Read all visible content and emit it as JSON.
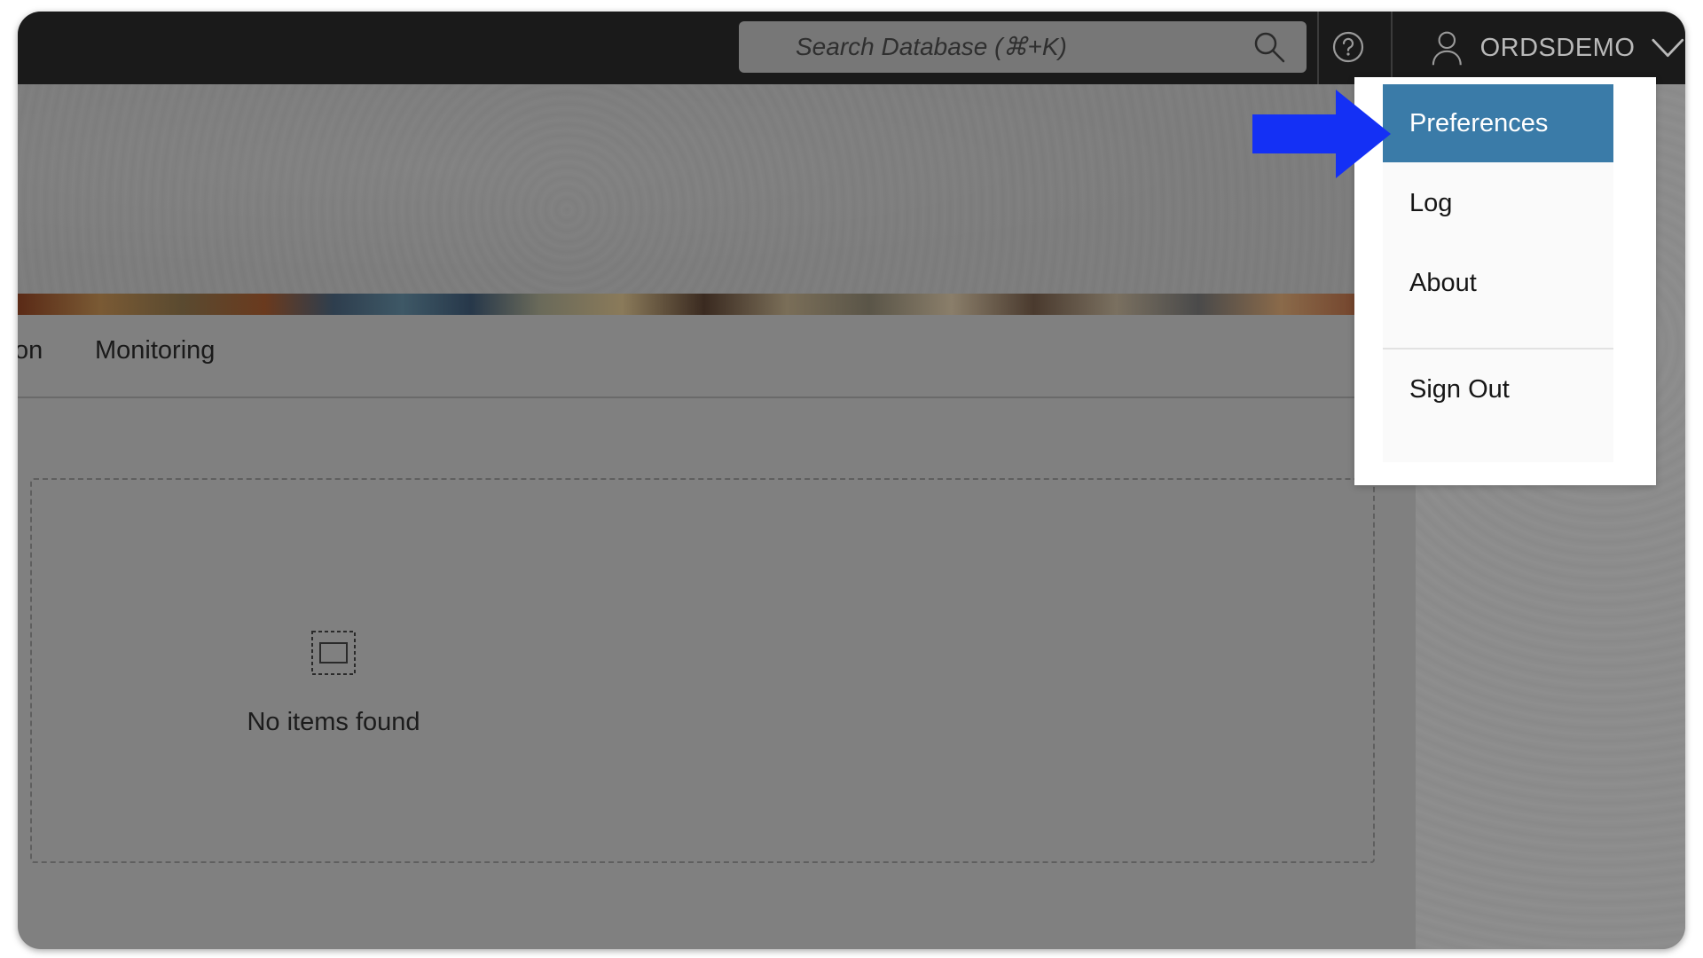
{
  "topbar": {
    "search": {
      "placeholder": "Search Database (⌘+K)",
      "icon": "search-icon"
    },
    "help": {
      "icon": "help-icon"
    },
    "user": {
      "name": "ORDSDEMO",
      "icon": "user-icon",
      "chevron": "chevron-down-icon"
    }
  },
  "nav": {
    "tabs": [
      {
        "label": "on"
      },
      {
        "label": "Monitoring"
      }
    ]
  },
  "main": {
    "empty_state": {
      "icon": "empty-icon",
      "message": "No items found"
    }
  },
  "user_menu": {
    "items": [
      {
        "label": "Preferences",
        "active": true
      },
      {
        "label": "Log"
      },
      {
        "label": "About"
      },
      {
        "label": "Sign Out"
      }
    ]
  },
  "annotation": {
    "arrow_color": "#1430f5"
  },
  "colors": {
    "topbar": "#1a1a1a",
    "overlay": "#808080",
    "menu_active": "#3a7ba8"
  }
}
